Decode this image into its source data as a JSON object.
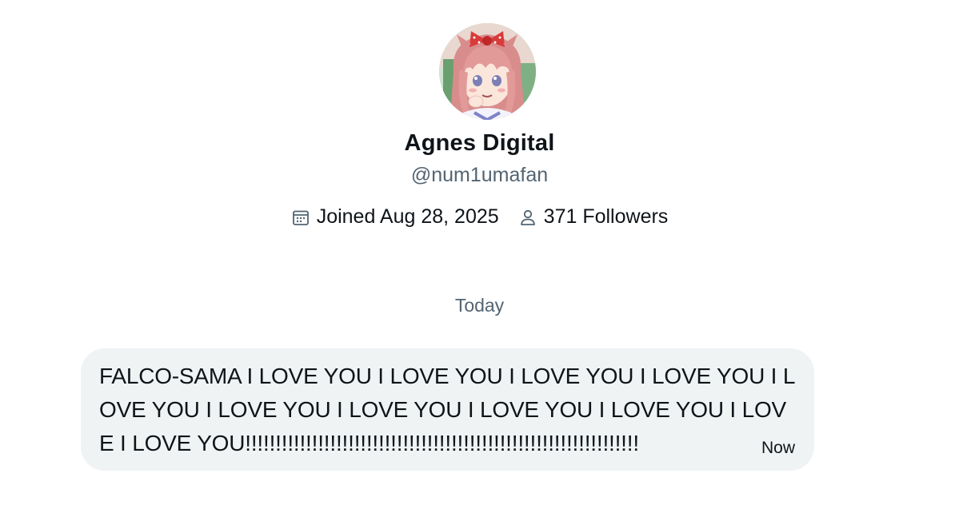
{
  "profile": {
    "avatar_alt": "avatar",
    "display_name": "Agnes Digital",
    "handle": "@num1umafan",
    "joined": "Joined Aug 28, 2025",
    "followers": "371 Followers",
    "calendar_icon": "calendar-icon",
    "person_icon": "person-icon"
  },
  "conversation": {
    "date_separator": "Today",
    "messages": [
      {
        "text": "FALCO-SAMA I LOVE YOU I LOVE YOU I LOVE YOU I LOVE YOU I LOVE YOU I LOVE YOU I LOVE YOU I LOVE YOU I LOVE YOU I LOVE I LOVE YOU!!!!!!!!!!!!!!!!!!!!!!!!!!!!!!!!!!!!!!!!!!!!!!!!!!!!!!!!!!!!!!!!!",
        "time": "Now"
      }
    ]
  },
  "colors": {
    "primary_text": "#0f1419",
    "secondary_text": "#536471",
    "bubble_background": "#eff3f4"
  }
}
